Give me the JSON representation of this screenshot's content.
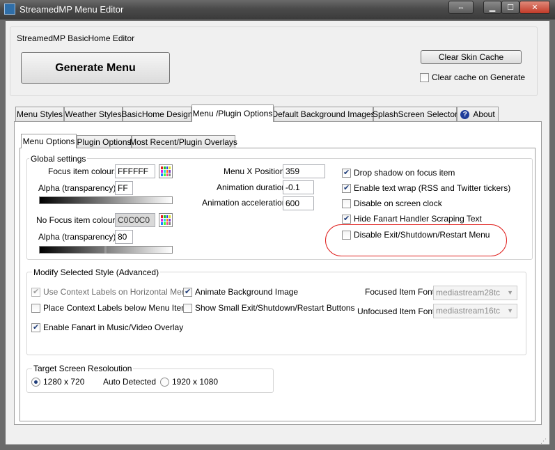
{
  "window": {
    "title": "StreamedMP Menu Editor"
  },
  "top_panel": {
    "label": "StreamedMP BasicHome Editor",
    "generate_label": "Generate Menu",
    "clear_label": "Clear Skin Cache",
    "clear_on_generate_label": "Clear cache on Generate"
  },
  "tabs": [
    "Menu Styles",
    "Weather Styles",
    "BasicHome Design",
    "Menu /Plugin Options",
    "Default Background Images",
    "SplashScreen Selector",
    "About"
  ],
  "subtabs": [
    "Menu Options",
    "Plugin Options",
    "Most Recent/Plugin Overlays"
  ],
  "global": {
    "label": "Global settings",
    "focus_label": "Focus item colour:",
    "focus_value": "FFFFFF",
    "alpha_label": "Alpha (transparency):",
    "alpha_value": "FF",
    "nofocus_label": "No Focus item colour:",
    "nofocus_value": "C0C0C0",
    "alpha2_value": "80",
    "menu_x_label": "Menu X Position:",
    "menu_x_value": "359",
    "anim_dur_label": "Animation duration:",
    "anim_dur_value": "-0.1",
    "anim_acc_label": "Animation acceleration:",
    "anim_acc_value": "600",
    "options": {
      "drop_shadow": "Drop shadow on focus item",
      "text_wrap": "Enable text wrap (RSS and Twitter tickers)",
      "disable_clock": "Disable on screen clock",
      "hide_fanart": "Hide Fanart Handler Scraping Text",
      "disable_exit": "Disable Exit/Shutdown/Restart Menu"
    }
  },
  "modify": {
    "label": "Modify Selected Style  (Advanced)",
    "use_context": "Use Context Labels on Horizontal Menu",
    "animate_bg": "Animate Background Image",
    "place_context": "Place Context Labels below Menu Item",
    "small_exit": "Show Small Exit/Shutdown/Restart Buttons",
    "enable_fanart": "Enable Fanart in Music/Video Overlay",
    "focused_font_label": "Focused Item Font:",
    "focused_font_value": "mediastream28tc",
    "unfocused_font_label": "Unfocused Item Font:",
    "unfocused_font_value": "mediastream16tc"
  },
  "resolution": {
    "label": "Target Screen Resoloution",
    "opt1": "1280 x 720",
    "auto": "Auto Detected",
    "opt2": "1920 x 1080"
  },
  "colors": {
    "annotation": "#e0201e",
    "checkmark": "#1f3d7a"
  }
}
